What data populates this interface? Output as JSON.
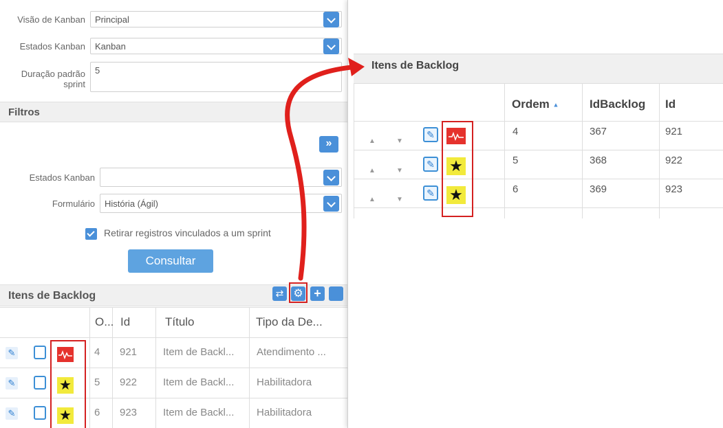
{
  "left": {
    "kanban_view_label": "Visão de Kanban",
    "kanban_view_value": "Principal",
    "kanban_states_label": "Estados Kanban",
    "kanban_states_value": "Kanban",
    "sprint_duration_label_1": "Duração padrão",
    "sprint_duration_label_2": "sprint",
    "sprint_duration_value": "5",
    "filters_title": "Filtros",
    "filter_states_label": "Estados Kanban",
    "filter_states_value": "",
    "form_label": "Formulário",
    "form_value": "História (Ágil)",
    "exclude_linked_label": "Retirar registros vinculados a um sprint",
    "exclude_linked_checked": true,
    "query_button": "Consultar",
    "backlog_title": "Itens de Backlog",
    "columns": [
      "O...",
      "Id",
      "Título",
      "Tipo da De..."
    ],
    "rows": [
      {
        "order": "4",
        "id": "921",
        "title": "Item de Backl...",
        "type": "Atendimento ...",
        "icon": "activity-icon"
      },
      {
        "order": "5",
        "id": "922",
        "title": "Item de Backl...",
        "type": "Habilitadora",
        "icon": "star-icon"
      },
      {
        "order": "6",
        "id": "923",
        "title": "Item de Backl...",
        "type": "Habilitadora",
        "icon": "star-icon"
      }
    ]
  },
  "right": {
    "title": "Itens de Backlog",
    "columns": [
      "Ordem",
      "IdBacklog",
      "Id"
    ],
    "sort_indicator": "▲",
    "rows": [
      {
        "order": "4",
        "idbacklog": "367",
        "id": "921",
        "icon": "activity-icon"
      },
      {
        "order": "5",
        "idbacklog": "368",
        "id": "922",
        "icon": "star-icon"
      },
      {
        "order": "6",
        "idbacklog": "369",
        "id": "923",
        "icon": "star-icon"
      }
    ]
  },
  "colors": {
    "accent_blue": "#4a90d9",
    "highlight_red": "#d42020",
    "activity_red": "#e5322d",
    "star_yellow": "#f2ea3c"
  }
}
